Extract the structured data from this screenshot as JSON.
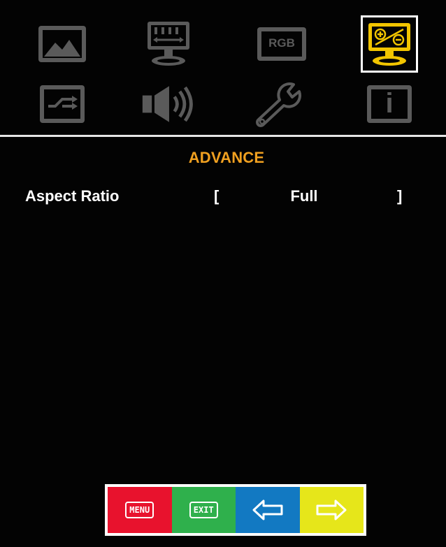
{
  "tabs": [
    {
      "id": "picture",
      "icon": "picture-icon",
      "selected": false
    },
    {
      "id": "geometry",
      "icon": "display-geometry-icon",
      "selected": false
    },
    {
      "id": "rgb",
      "icon": "rgb-icon",
      "label": "RGB",
      "selected": false
    },
    {
      "id": "advance",
      "icon": "advance-display-icon",
      "selected": true
    },
    {
      "id": "input",
      "icon": "input-source-icon",
      "selected": false
    },
    {
      "id": "audio",
      "icon": "speaker-icon",
      "selected": false
    },
    {
      "id": "setup",
      "icon": "wrench-icon",
      "selected": false
    },
    {
      "id": "info",
      "icon": "info-icon",
      "label": "i",
      "selected": false
    }
  ],
  "menu": {
    "title": "ADVANCE",
    "items": [
      {
        "label": "Aspect Ratio",
        "open_bracket": "[",
        "value": "Full",
        "close_bracket": "]"
      }
    ]
  },
  "buttons": {
    "menu_label": "MENU",
    "exit_label": "EXIT",
    "left_icon": "left-arrow-icon",
    "right_icon": "right-arrow-icon"
  },
  "colors": {
    "background": "#030303",
    "icon_gray": "#5a5a5a",
    "accent": "#f0a020",
    "selected_icon": "#f2c500",
    "menu_button": "#e8122d",
    "exit_button": "#2fb04c",
    "left_button": "#1279c2",
    "right_button": "#e6e61a"
  }
}
